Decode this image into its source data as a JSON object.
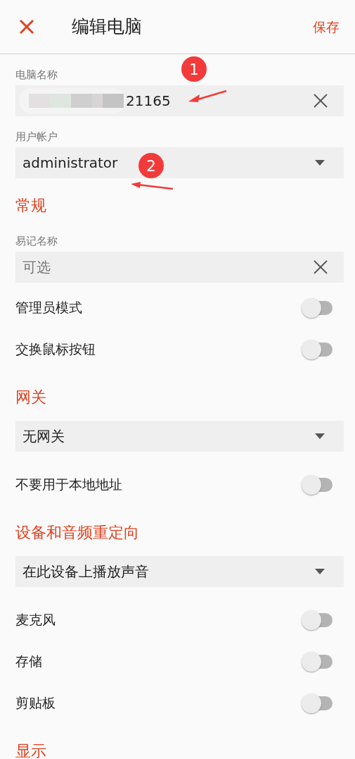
{
  "header": {
    "title": "编辑电脑",
    "save": "保存"
  },
  "items": [
    {
      "kind": "text_field",
      "label": "电脑名称",
      "value": "21165",
      "redacted": true,
      "clearable": true
    },
    {
      "kind": "select",
      "label": "用户帐户",
      "value": "administrator"
    },
    {
      "kind": "heading",
      "text": "常规"
    },
    {
      "kind": "text_field",
      "label": "易记名称",
      "placeholder": "可选",
      "redacted": false,
      "clearable": true
    },
    {
      "kind": "switch",
      "label": "管理员模式",
      "on": false
    },
    {
      "kind": "switch",
      "label": "交换鼠标按钮",
      "on": false
    },
    {
      "kind": "heading",
      "text": "网关"
    },
    {
      "kind": "select",
      "value": "无网关"
    },
    {
      "kind": "switch",
      "label": "不要用于本地地址",
      "on": false
    },
    {
      "kind": "heading",
      "text": "设备和音频重定向"
    },
    {
      "kind": "select",
      "value": "在此设备上播放声音"
    },
    {
      "kind": "switch",
      "label": "麦克风",
      "on": false
    },
    {
      "kind": "switch",
      "label": "存储",
      "on": false
    },
    {
      "kind": "switch",
      "label": "剪贴板",
      "on": false
    },
    {
      "kind": "heading",
      "text": "显示"
    }
  ],
  "annotations": [
    {
      "number": "1"
    },
    {
      "number": "2"
    }
  ]
}
